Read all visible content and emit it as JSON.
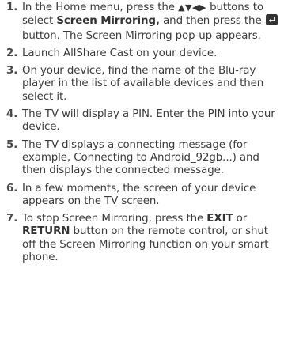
{
  "steps": [
    {
      "num": "1.",
      "parts": {
        "a": "In the Home menu, press the ",
        "arrows": "▲▼◀▶",
        "b": " buttons to select ",
        "bold1": "Screen Mirroring,",
        "c": " and then press the ",
        "icon": "enter-button-icon",
        "d": " button. The Screen Mirroring pop-up appears."
      }
    },
    {
      "num": "2.",
      "text": "Launch AllShare Cast on your device."
    },
    {
      "num": "3.",
      "text": "On your device, find the name of the Blu-ray player in the list of available devices and then select it."
    },
    {
      "num": "4.",
      "text": "The TV will display a PIN. Enter the PIN into your device."
    },
    {
      "num": "5.",
      "text": "The TV displays a connecting message (for example, Connecting to Android_92gb...) and then displays the connected message."
    },
    {
      "num": "6.",
      "text": "In a few moments, the screen of your device appears on the TV screen."
    },
    {
      "num": "7.",
      "parts": {
        "a": "To stop Screen Mirroring, press the ",
        "bold1": "EXIT",
        "b": " or ",
        "bold2": "RETURN",
        "c": " button on the remote control, or shut off the Screen Mirroring function on your smart phone."
      }
    }
  ],
  "colors": {
    "text": "#3a3a3a",
    "icon_bg": "#333333",
    "icon_fg": "#ffffff"
  }
}
